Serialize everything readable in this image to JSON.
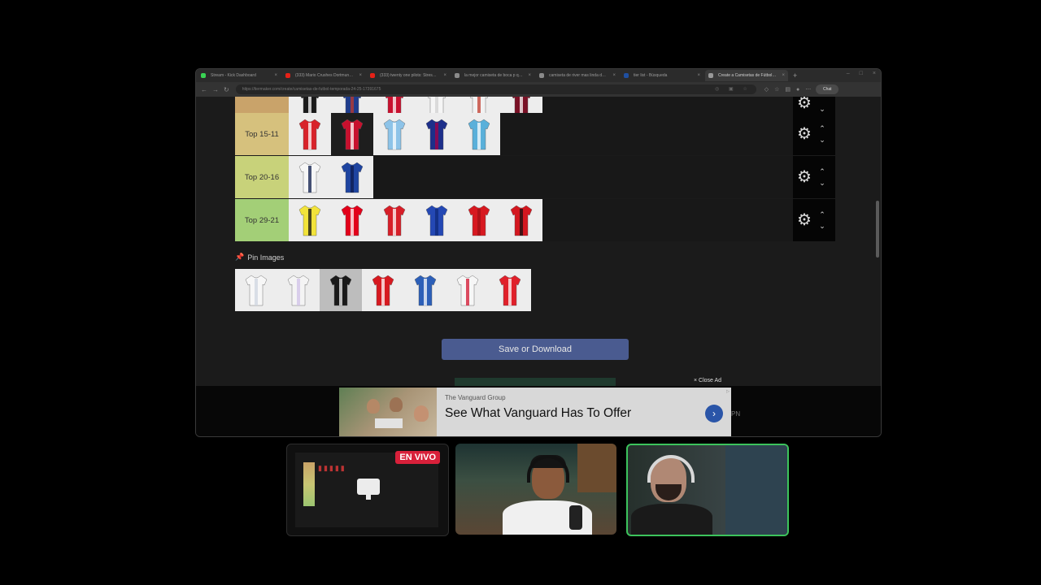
{
  "browser": {
    "tabs": [
      {
        "title": "Stream - Kick Dashboard",
        "color": "#39d353",
        "active": false
      },
      {
        "title": "(333) Mario Crushes Dortmund's",
        "color": "#e62117",
        "active": false
      },
      {
        "title": "(333) twenty one pilots: Stressed O",
        "color": "#e62117",
        "active": false
      },
      {
        "title": "la mejor camiseta de boca p quién",
        "color": "#8a8a8a",
        "active": false
      },
      {
        "title": "camiseta de river mas linda del m",
        "color": "#8a8a8a",
        "active": false
      },
      {
        "title": "tier list - Búsqueda",
        "color": "#1f4fa0",
        "active": false
      },
      {
        "title": "Create a Camisetas de Fútbol tier",
        "color": "#999999",
        "active": true
      }
    ],
    "new_tab": "+",
    "url": "https://tiermaker.com/create/camisetas-de-futbol-temporada-24-25-17391675",
    "chat_label": "Chat"
  },
  "tiers": [
    {
      "label": "",
      "color": "#c9a36a",
      "jerseys": [
        {
          "name": "jersey-black-white",
          "color": "#1a1a1a",
          "accent": "#ffffff",
          "bg": "#ededed"
        },
        {
          "name": "jersey-navy",
          "color": "#1f3c8c",
          "accent": "#c0392b",
          "bg": "#ededed"
        },
        {
          "name": "jersey-red",
          "color": "#c8102e",
          "accent": "#ffffff",
          "bg": "#ededed"
        },
        {
          "name": "jersey-white",
          "color": "#f5f5f5",
          "accent": "#d0d0d0",
          "bg": "#ededed"
        },
        {
          "name": "jersey-white-2",
          "color": "#f2f2f2",
          "accent": "#c0392b",
          "bg": "#ededed"
        },
        {
          "name": "jersey-maroon",
          "color": "#7a1126",
          "accent": "#ffffff",
          "bg": "#ededed"
        }
      ]
    },
    {
      "label": "Top 15-11",
      "color": "#d6c17d",
      "jerseys": [
        {
          "name": "jersey-red-stripes",
          "color": "#d8232a",
          "accent": "#ffffff",
          "bg": "#ededed"
        },
        {
          "name": "jersey-red-white-stripes",
          "color": "#c8102e",
          "accent": "#ffffff",
          "bg": "#1e1e1e"
        },
        {
          "name": "jersey-sky-blue",
          "color": "#8dc3e8",
          "accent": "#ffffff",
          "bg": "#ededed"
        },
        {
          "name": "jersey-blaugrana",
          "color": "#1d2f8a",
          "accent": "#a50044",
          "bg": "#ededed"
        },
        {
          "name": "jersey-light-blue",
          "color": "#5ab0da",
          "accent": "#ffffff",
          "bg": "#ededed"
        }
      ]
    },
    {
      "label": "Top 20-16",
      "color": "#c8d27a",
      "jerseys": [
        {
          "name": "jersey-spurs-white",
          "color": "#f6f6f6",
          "accent": "#0a1a4a",
          "bg": "#ededed"
        },
        {
          "name": "jersey-blue-pattern",
          "color": "#1e44a0",
          "accent": "#0d1b4d",
          "bg": "#ededed"
        }
      ]
    },
    {
      "label": "Top 29-21",
      "color": "#a3cf77",
      "jerseys": [
        {
          "name": "jersey-yellow-black",
          "color": "#f2e33a",
          "accent": "#111111",
          "bg": "#ededed"
        },
        {
          "name": "jersey-red-white-split",
          "color": "#e2001a",
          "accent": "#ffffff",
          "bg": "#ededed"
        },
        {
          "name": "jersey-red-checkers",
          "color": "#d71e28",
          "accent": "#ffffff",
          "bg": "#ededed"
        },
        {
          "name": "jersey-blue-royal",
          "color": "#2448b4",
          "accent": "#0f2a7a",
          "bg": "#ededed"
        },
        {
          "name": "jersey-red-plain",
          "color": "#d71920",
          "accent": "#a01016",
          "bg": "#ededed"
        },
        {
          "name": "jersey-red-black",
          "color": "#d3171f",
          "accent": "#111111",
          "bg": "#ededed"
        }
      ]
    }
  ],
  "pin": {
    "title": "Pin Images",
    "jerseys": [
      {
        "name": "pin-jersey-white-1",
        "color": "#f7f7f7",
        "accent": "#cfd5e0",
        "bg": "#ededed"
      },
      {
        "name": "pin-jersey-white-2",
        "color": "#f4f4f4",
        "accent": "#d0c2e8",
        "bg": "#ededed"
      },
      {
        "name": "pin-jersey-black-white",
        "color": "#1a1a1a",
        "accent": "#f2f2f2",
        "bg": "#bdbdbd"
      },
      {
        "name": "pin-jersey-red",
        "color": "#d71920",
        "accent": "#ffffff",
        "bg": "#ededed"
      },
      {
        "name": "pin-jersey-blue-white",
        "color": "#2c5fb8",
        "accent": "#ffffff",
        "bg": "#ededed"
      },
      {
        "name": "pin-jersey-ajax",
        "color": "#f6f6f6",
        "accent": "#d2122e",
        "bg": "#ededed"
      },
      {
        "name": "pin-jersey-red-white",
        "color": "#e0202a",
        "accent": "#ffffff",
        "bg": "#ededed"
      }
    ]
  },
  "save_button": "Save or Download",
  "ad": {
    "close_label": "× Close Ad",
    "company": "The Vanguard Group",
    "headline": "See What Vanguard Has To Offer",
    "go": "›",
    "side_text": "PN"
  },
  "stream": {
    "live_label": "EN VIVO"
  },
  "icons": {
    "gear": "⚙",
    "up": "⌃",
    "down": "⌄",
    "pin": "📌"
  }
}
